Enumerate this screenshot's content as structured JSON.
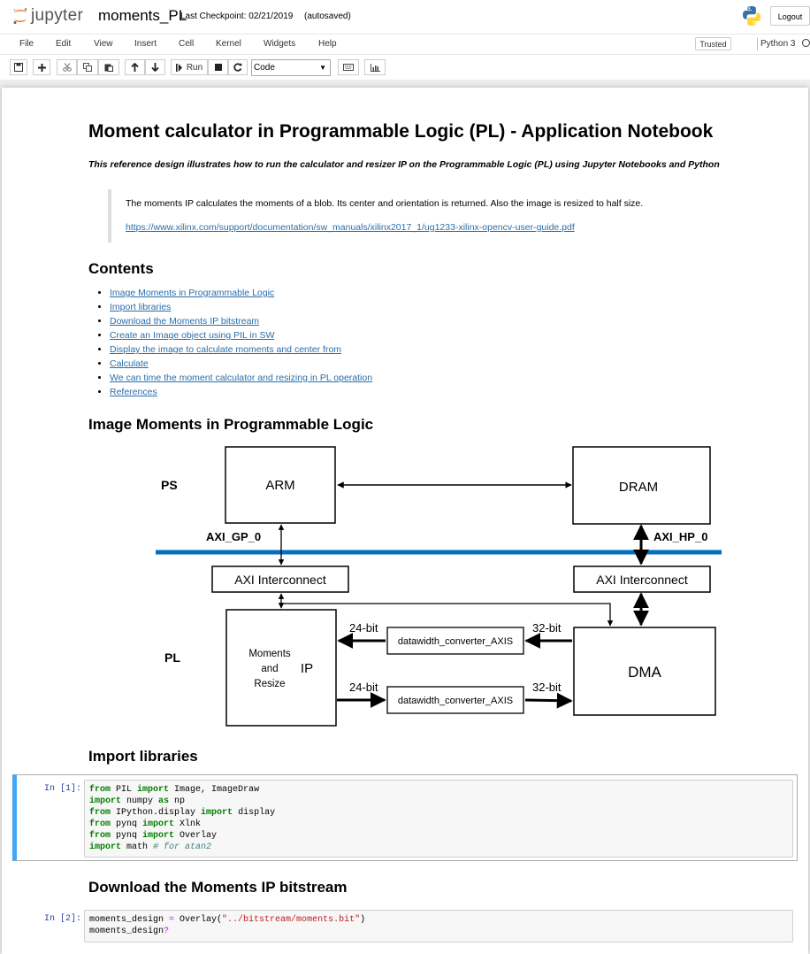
{
  "header": {
    "logo_text": "jupyter",
    "notebook_name": "moments_PL",
    "checkpoint": "Last Checkpoint: 02/21/2019",
    "autosaved": "(autosaved)",
    "logout_label": "Logout",
    "logo_icon": "jupyter-logo-icon",
    "kernel_logo_icon": "python-logo-icon"
  },
  "menu": {
    "items": [
      "File",
      "Edit",
      "View",
      "Insert",
      "Cell",
      "Kernel",
      "Widgets",
      "Help"
    ],
    "trusted_label": "Trusted",
    "kernel_name": "Python 3"
  },
  "toolbar": {
    "run_label": "Run",
    "cell_type": "Code",
    "icons": [
      "save-icon",
      "plus-icon",
      "cut-icon",
      "copy-icon",
      "paste-icon",
      "arrow-up-icon",
      "arrow-down-icon",
      "run-icon",
      "stop-icon",
      "restart-icon",
      "keyboard-icon",
      "chart-icon"
    ]
  },
  "notebook": {
    "title": "Moment calculator in Programmable Logic (PL) - Application Notebook",
    "subtitle": "This reference design illustrates how to run the calculator and resizer IP on the Programmable Logic (PL) using Jupyter Notebooks and Python",
    "quote_text": "The moments IP calculates the moments of a blob. Its center and orientation is returned. Also the image is resized to half size.",
    "quote_link": "https://www.xilinx.com/support/documentation/sw_manuals/xilinx2017_1/ug1233-xilinx-opencv-user-guide.pdf",
    "contents_heading": "Contents",
    "contents": [
      "Image Moments in Programmable Logic",
      "Import libraries",
      "Download the Moments IP bitstream",
      "Create an Image object using PIL in SW",
      "Display the image to calculate moments and center from",
      "Calculate",
      "We can time the moment calculator and resizing in PL operation",
      "References"
    ],
    "section_image_moments": "Image Moments in Programmable Logic",
    "section_import": "Import libraries",
    "section_download": "Download the Moments IP bitstream"
  },
  "diagram": {
    "ps_label": "PS",
    "pl_label": "PL",
    "arm": "ARM",
    "dram": "DRAM",
    "axi_gp": "AXI_GP_0",
    "axi_hp": "AXI_HP_0",
    "axi_interconnect_left": "AXI Interconnect",
    "axi_interconnect_right": "AXI Interconnect",
    "ip_line1": "Moments",
    "ip_line2": "and",
    "ip_line3": "Resize",
    "ip_label": "IP",
    "dma": "DMA",
    "converter_top": "datawidth_converter_AXIS",
    "converter_bottom": "datawidth_converter_AXIS",
    "bits_24_top": "24-bit",
    "bits_32_top": "32-bit",
    "bits_24_bottom": "24-bit",
    "bits_32_bottom": "32-bit",
    "bus_color": "#0070c0"
  },
  "cells": {
    "cell1_prompt": "In [1]:",
    "cell2_prompt": "In [2]:"
  }
}
